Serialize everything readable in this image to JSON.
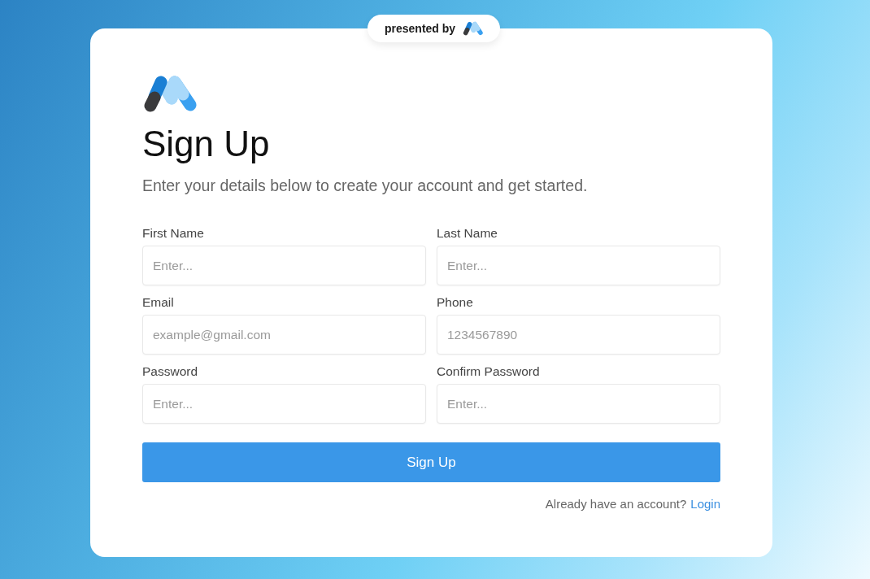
{
  "badge": {
    "text": "presented by"
  },
  "heading": "Sign Up",
  "subtitle": "Enter your details below to create your account and get started.",
  "fields": [
    {
      "label": "First Name",
      "placeholder": "Enter..."
    },
    {
      "label": "Last Name",
      "placeholder": "Enter..."
    },
    {
      "label": "Email",
      "placeholder": "example@gmail.com"
    },
    {
      "label": "Phone",
      "placeholder": "1234567890"
    },
    {
      "label": "Password",
      "placeholder": "Enter..."
    },
    {
      "label": "Confirm Password",
      "placeholder": "Enter..."
    }
  ],
  "submit": "Sign Up",
  "footer": {
    "text": "Already have an account?",
    "link": "Login"
  }
}
